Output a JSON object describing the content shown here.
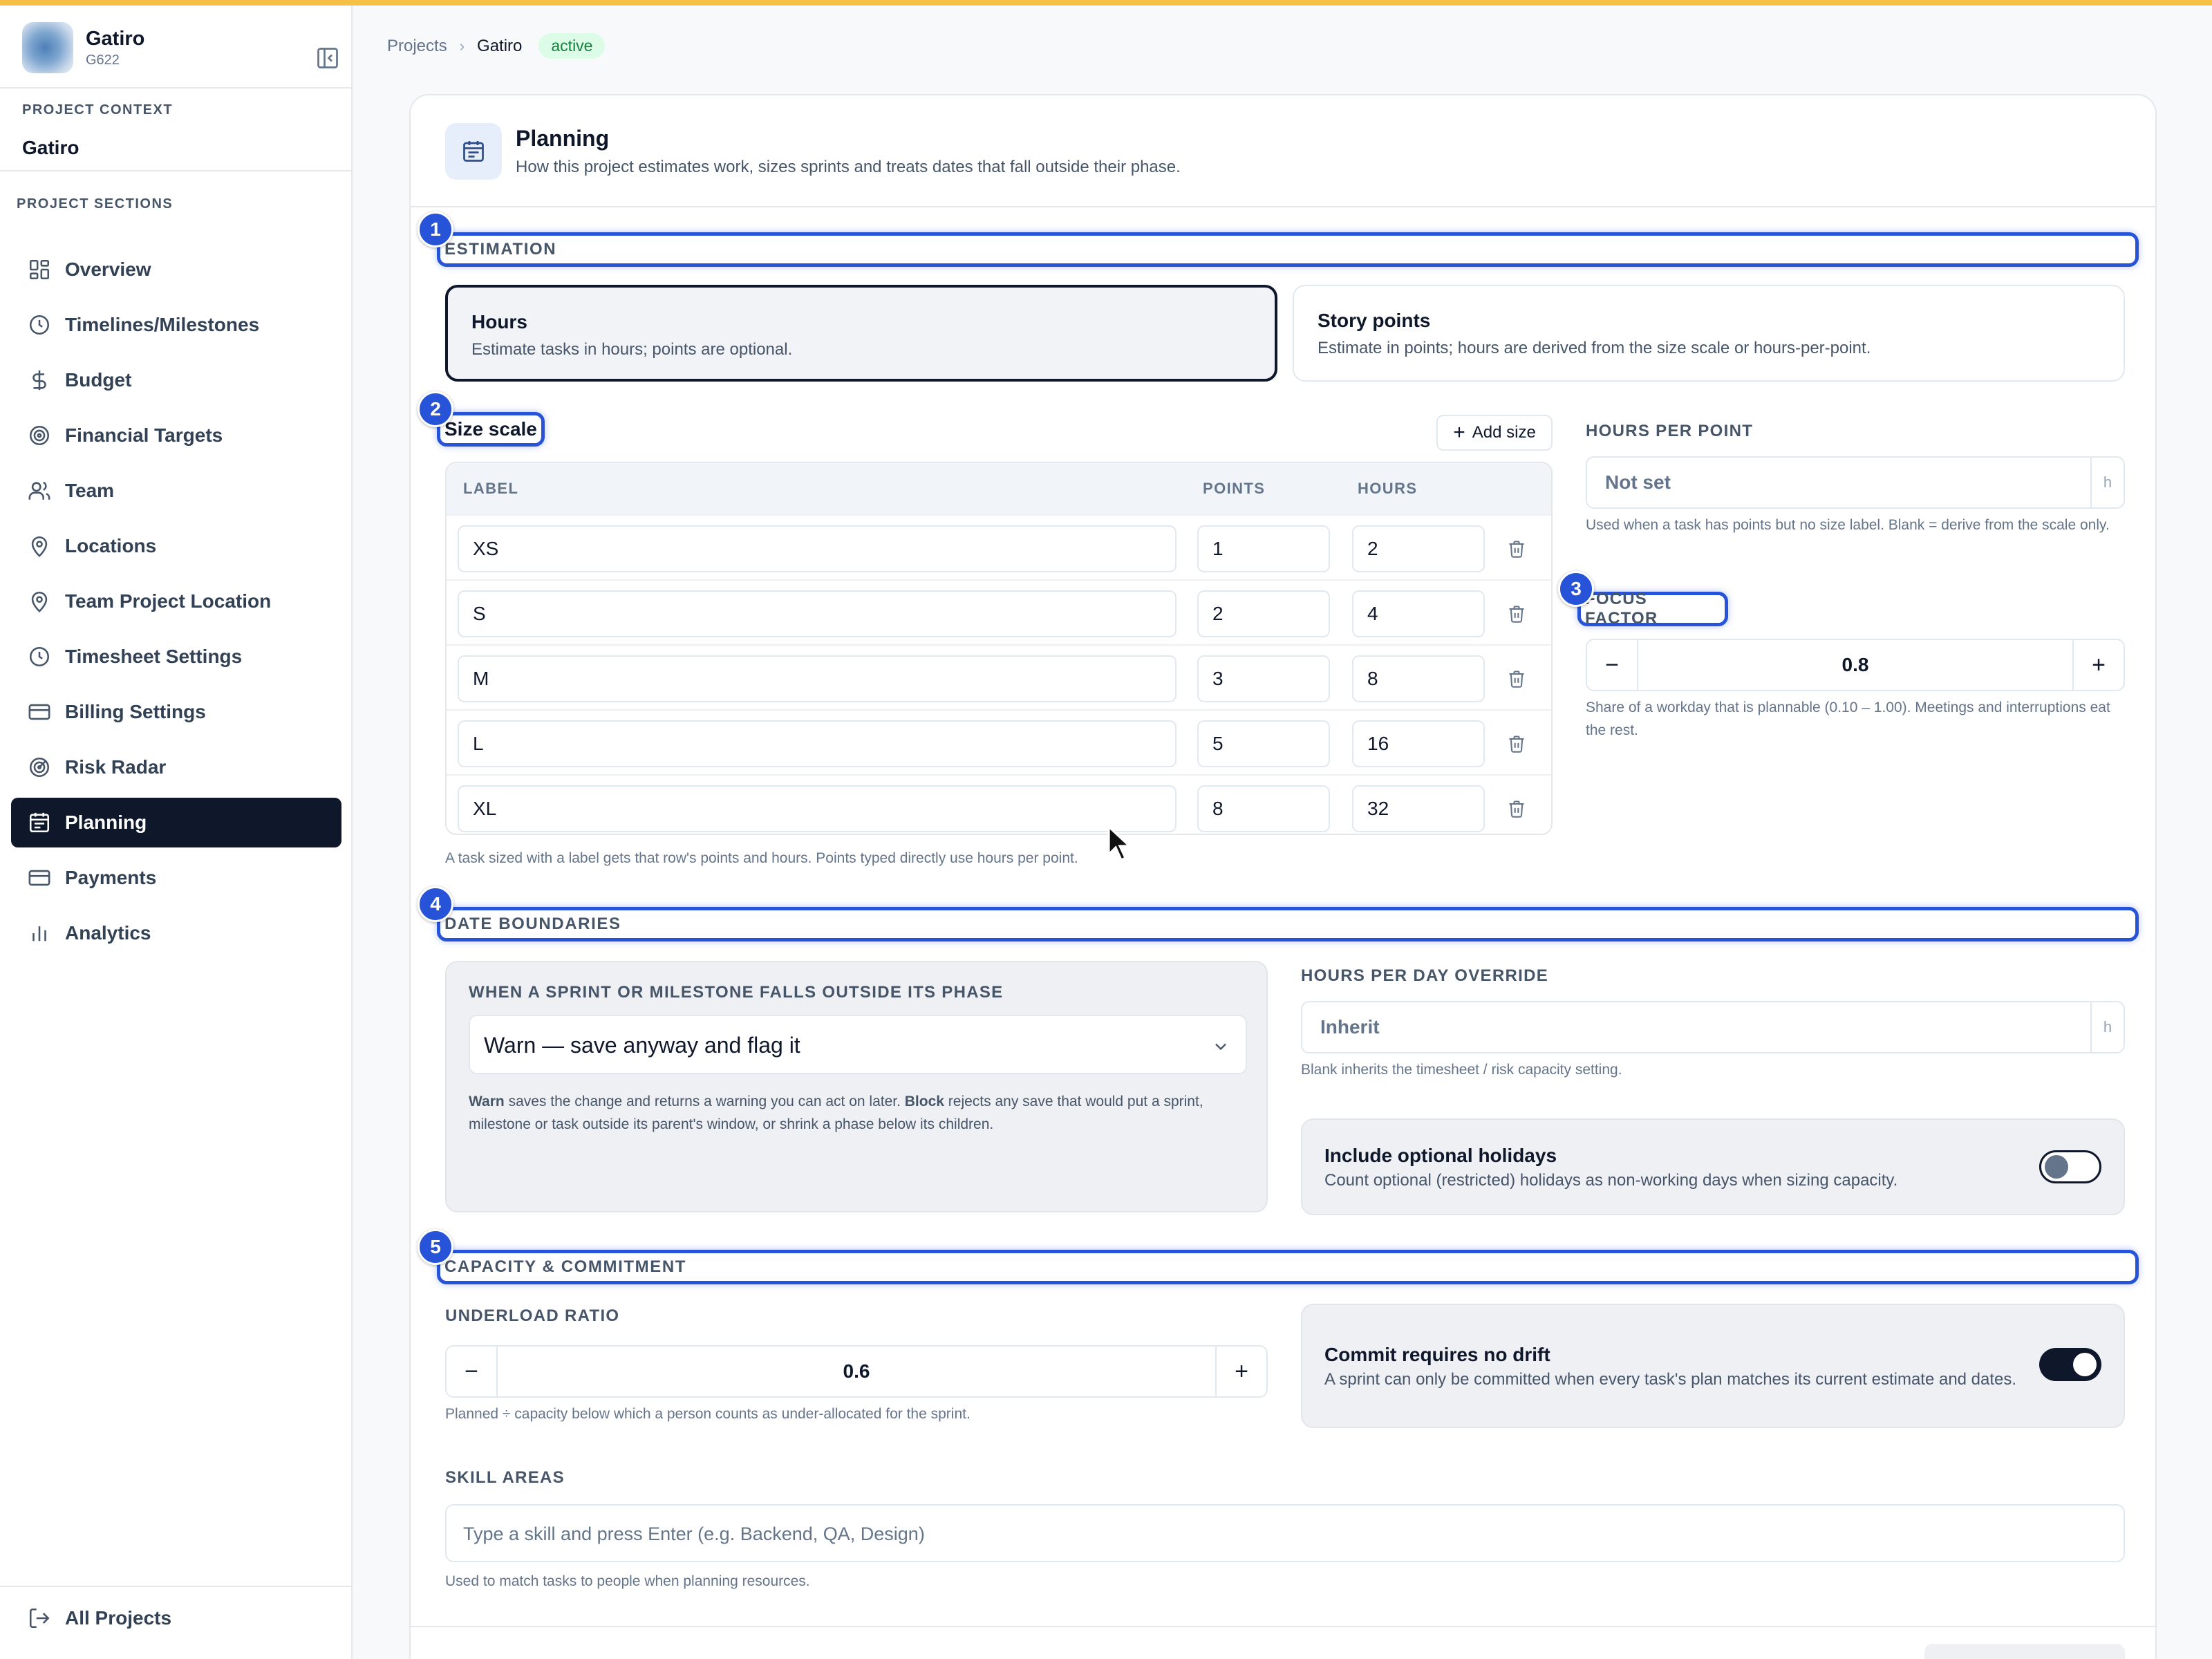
{
  "brand": {
    "name": "Gatiro",
    "code": "G622"
  },
  "sidebar": {
    "project_context_label": "PROJECT CONTEXT",
    "project_context_name": "Gatiro",
    "sections_label": "PROJECT SECTIONS",
    "items": [
      {
        "label": "Overview",
        "icon": "grid-icon"
      },
      {
        "label": "Timelines/Milestones",
        "icon": "clock-icon"
      },
      {
        "label": "Budget",
        "icon": "dollar-icon"
      },
      {
        "label": "Financial Targets",
        "icon": "target-icon"
      },
      {
        "label": "Team",
        "icon": "users-icon"
      },
      {
        "label": "Locations",
        "icon": "map-pin-icon"
      },
      {
        "label": "Team Project Location",
        "icon": "map-pin-icon"
      },
      {
        "label": "Timesheet Settings",
        "icon": "clock-icon"
      },
      {
        "label": "Billing Settings",
        "icon": "credit-card-icon"
      },
      {
        "label": "Risk Radar",
        "icon": "radar-icon"
      },
      {
        "label": "Planning",
        "icon": "calendar-icon",
        "active": true
      },
      {
        "label": "Payments",
        "icon": "credit-card-icon"
      },
      {
        "label": "Analytics",
        "icon": "bar-chart-icon"
      }
    ],
    "all_projects": "All Projects"
  },
  "breadcrumb": {
    "root": "Projects",
    "current": "Gatiro",
    "status": "active"
  },
  "planning": {
    "title": "Planning",
    "description": "How this project estimates work, sizes sprints and treats dates that fall outside their phase."
  },
  "badges": {
    "b1": "1",
    "b2": "2",
    "b3": "3",
    "b4": "4",
    "b5": "5"
  },
  "estimation": {
    "section_label": "ESTIMATION",
    "options": [
      {
        "title": "Hours",
        "desc": "Estimate tasks in hours; points are optional.",
        "selected": true
      },
      {
        "title": "Story points",
        "desc": "Estimate in points; hours are derived from the size scale or hours-per-point.",
        "selected": false
      }
    ]
  },
  "size_scale": {
    "title": "Size scale",
    "add_label": "Add size",
    "columns": {
      "label": "LABEL",
      "points": "POINTS",
      "hours": "HOURS"
    },
    "rows": [
      {
        "label": "XS",
        "points": "1",
        "hours": "2"
      },
      {
        "label": "S",
        "points": "2",
        "hours": "4"
      },
      {
        "label": "M",
        "points": "3",
        "hours": "8"
      },
      {
        "label": "L",
        "points": "5",
        "hours": "16"
      },
      {
        "label": "XL",
        "points": "8",
        "hours": "32"
      }
    ],
    "help": "A task sized with a label gets that row's points and hours. Points typed directly use hours per point."
  },
  "hours_per_point": {
    "label": "HOURS PER POINT",
    "placeholder": "Not set",
    "unit": "h",
    "help": "Used when a task has points but no size label. Blank = derive from the scale only."
  },
  "focus_factor": {
    "label": "FOCUS FACTOR",
    "value": "0.8",
    "minus": "−",
    "plus": "+",
    "help": "Share of a workday that is plannable (0.10 – 1.00). Meetings and interruptions eat the rest."
  },
  "date_boundaries": {
    "section_label": "DATE BOUNDARIES",
    "phase_label": "WHEN A SPRINT OR MILESTONE FALLS OUTSIDE ITS PHASE",
    "phase_value": "Warn — save anyway and flag it",
    "help_warn": "Warn",
    "help_1": " saves the change and returns a warning you can act on later. ",
    "help_block": "Block",
    "help_2": " rejects any save that would put a sprint, milestone or task outside its parent's window, or shrink a phase below its children.",
    "hours_override_label": "HOURS PER DAY OVERRIDE",
    "hours_override_placeholder": "Inherit",
    "hours_override_unit": "h",
    "hours_override_help": "Blank inherits the timesheet / risk capacity setting.",
    "holidays_title": "Include optional holidays",
    "holidays_desc": "Count optional (restricted) holidays as non-working days when sizing capacity.",
    "holidays_on": false
  },
  "capacity": {
    "section_label": "CAPACITY & COMMITMENT",
    "underload_label": "UNDERLOAD RATIO",
    "underload_value": "0.6",
    "minus": "−",
    "plus": "+",
    "underload_help": "Planned ÷ capacity below which a person counts as under-allocated for the sprint.",
    "commit_title": "Commit requires no drift",
    "commit_desc": "A sprint can only be committed when every task's plan matches its current estimate and dates.",
    "commit_on": true,
    "skills_label": "SKILL AREAS",
    "skills_placeholder": "Type a skill and press Enter (e.g. Backend, QA, Design)",
    "skills_help": "Used to match tasks to people when planning resources."
  },
  "colors": {
    "accent": "#2753d9",
    "active_nav": "#0f172a",
    "top_bar": "#f5c046",
    "badge_bg": "#dcfce7"
  }
}
